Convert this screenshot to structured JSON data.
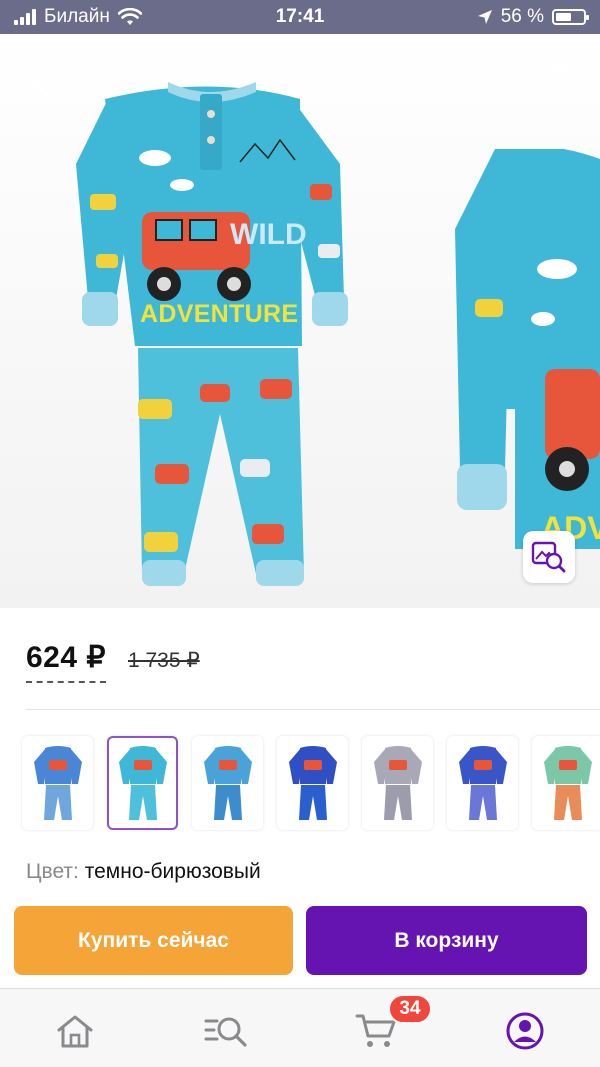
{
  "status_bar": {
    "carrier": "Билайн",
    "time": "17:41",
    "battery": "56 %",
    "battery_level": 0.56
  },
  "product": {
    "print_text_1": "WILD",
    "print_text_2": "ADVENTURE",
    "peek_print_text": "ADV",
    "price_current": "624 ₽",
    "price_old": "1 735 ₽",
    "color_label": "Цвет:",
    "color_value": "темно-бирюзовый"
  },
  "variants": [
    {
      "shirt": "#4a86d6",
      "pants": "#6fa7dd",
      "selected": false
    },
    {
      "shirt": "#3fb8d8",
      "pants": "#4fc0dc",
      "selected": true
    },
    {
      "shirt": "#4aa3d8",
      "pants": "#3d8ccc",
      "selected": false
    },
    {
      "shirt": "#2f4fc2",
      "pants": "#2a5fd0",
      "selected": false
    },
    {
      "shirt": "#a8a8b6",
      "pants": "#9c9cad",
      "selected": false
    },
    {
      "shirt": "#3a55c8",
      "pants": "#6a77d6",
      "selected": false
    },
    {
      "shirt": "#7cc7a8",
      "pants": "#e88d5a",
      "selected": false
    }
  ],
  "actions": {
    "buy_now": "Купить сейчас",
    "add_to_cart": "В корзину"
  },
  "tabbar": {
    "cart_count": "34",
    "items": [
      {
        "icon": "home-icon"
      },
      {
        "icon": "catalog-search-icon"
      },
      {
        "icon": "cart-icon"
      },
      {
        "icon": "profile-icon"
      }
    ]
  },
  "colors": {
    "accent_purple": "#6514b1",
    "buy_orange": "#f5a437",
    "badge_red": "#f0473c",
    "pajama_turquoise": "#3fb8d8"
  }
}
